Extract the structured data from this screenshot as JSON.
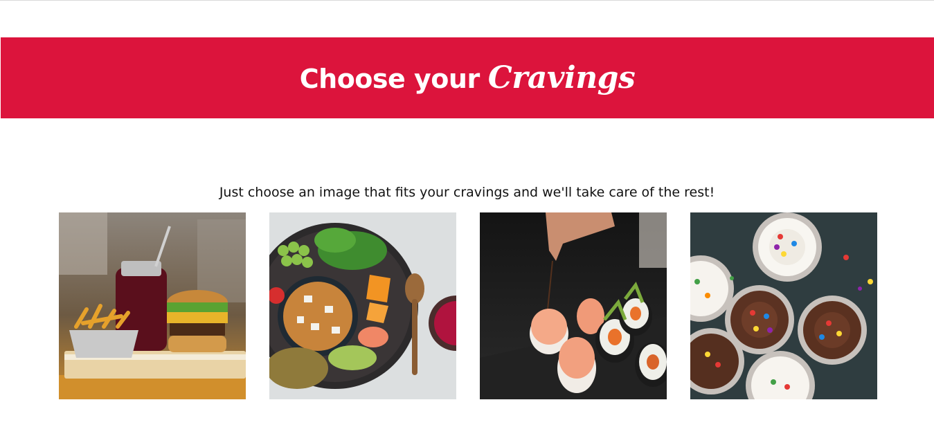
{
  "header": {
    "title_lead": "Choose your",
    "title_emphasis": "Cravings",
    "background_color": "#dc143c"
  },
  "intro": {
    "text": "Just choose an image that fits your cravings and we'll take care of the rest!"
  },
  "gallery": {
    "items": [
      {
        "name": "burger-and-fries-image"
      },
      {
        "name": "buddha-bowl-image"
      },
      {
        "name": "sushi-image"
      },
      {
        "name": "cupcakes-image"
      }
    ]
  }
}
